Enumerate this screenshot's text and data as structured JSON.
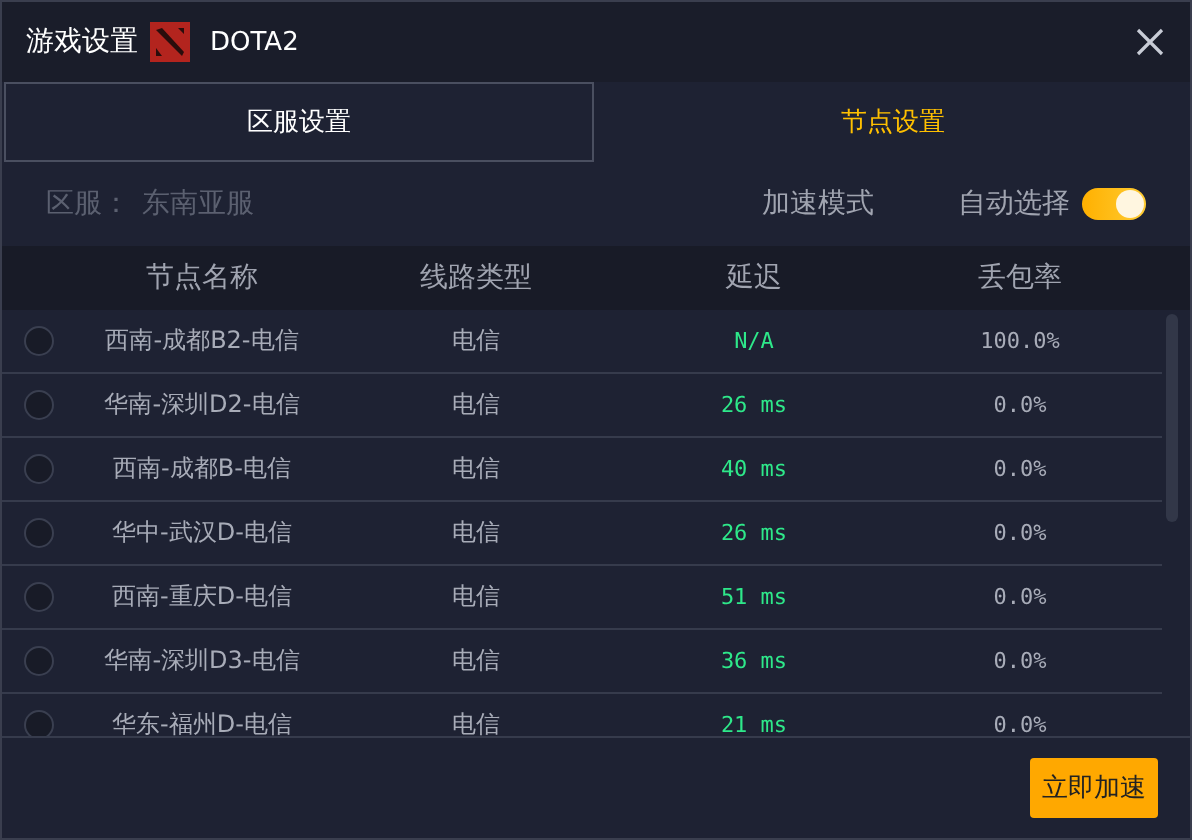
{
  "window": {
    "title": "游戏设置",
    "game": "DOTA2"
  },
  "tabs": [
    {
      "label": "区服设置",
      "selected": false
    },
    {
      "label": "节点设置",
      "selected": true
    }
  ],
  "region": {
    "label": "区服：",
    "value": "东南亚服"
  },
  "mode": {
    "label": "加速模式",
    "option": "自动选择",
    "on": true
  },
  "table": {
    "columns": [
      "节点名称",
      "线路类型",
      "延迟",
      "丢包率"
    ],
    "rows": [
      {
        "selected": false,
        "name": "西南-成都B2-电信",
        "line": "电信",
        "latency": "N/A",
        "loss": "100.0%"
      },
      {
        "selected": false,
        "name": "华南-深圳D2-电信",
        "line": "电信",
        "latency": "26 ms",
        "loss": "0.0%"
      },
      {
        "selected": false,
        "name": "西南-成都B-电信",
        "line": "电信",
        "latency": "40 ms",
        "loss": "0.0%"
      },
      {
        "selected": false,
        "name": "华中-武汉D-电信",
        "line": "电信",
        "latency": "26 ms",
        "loss": "0.0%"
      },
      {
        "selected": false,
        "name": "西南-重庆D-电信",
        "line": "电信",
        "latency": "51 ms",
        "loss": "0.0%"
      },
      {
        "selected": false,
        "name": "华南-深圳D3-电信",
        "line": "电信",
        "latency": "36 ms",
        "loss": "0.0%"
      },
      {
        "selected": false,
        "name": "华东-福州D-电信",
        "line": "电信",
        "latency": "21 ms",
        "loss": "0.0%"
      }
    ]
  },
  "footer": {
    "button": "立即加速"
  }
}
